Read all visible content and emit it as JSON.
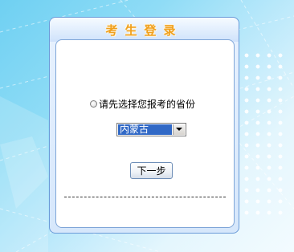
{
  "login_panel": {
    "title": "考生登录",
    "province_prompt": "请先选择您报考的省份",
    "province_select": {
      "selected": "内蒙古"
    },
    "next_button_label": "下一步"
  },
  "colors": {
    "title_accent": "#f0a01e",
    "select_highlight": "#3169c6",
    "panel_border": "#6a9ad8"
  },
  "icons": {
    "radio": "radio-icon",
    "dropdown": "chevron-down-icon"
  }
}
